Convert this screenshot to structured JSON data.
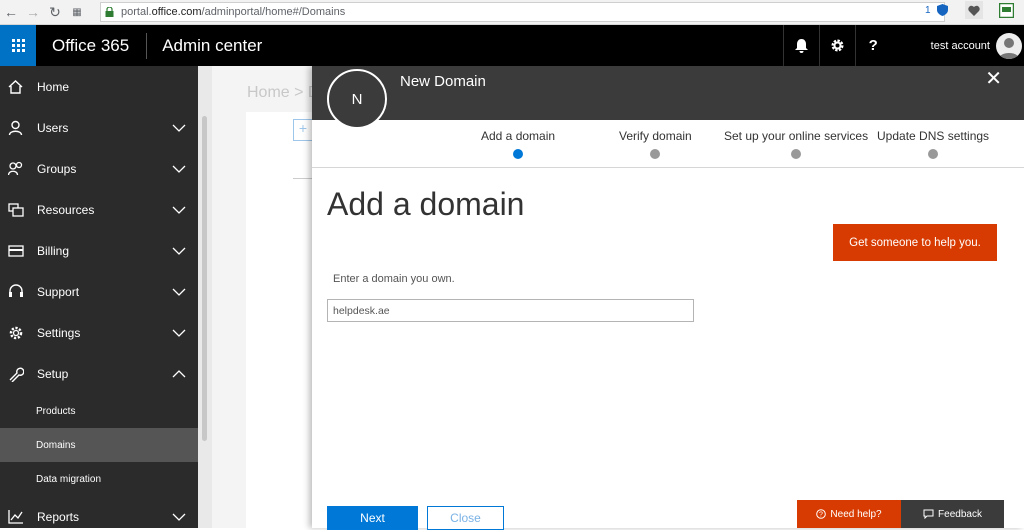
{
  "browser": {
    "url_prefix": "portal.",
    "url_domain": "office.com",
    "url_path": "/adminportal/home#/Domains",
    "badge_count": "1"
  },
  "suite": {
    "brand": "Office 365",
    "app_name": "Admin center",
    "account": "test account"
  },
  "nav": {
    "home": "Home",
    "users": "Users",
    "groups": "Groups",
    "resources": "Resources",
    "billing": "Billing",
    "support": "Support",
    "settings": "Settings",
    "setup": "Setup",
    "sub": {
      "products": "Products",
      "domains": "Domains",
      "data_migration": "Data migration"
    },
    "reports": "Reports"
  },
  "background": {
    "breadcrumb": "Home > D",
    "add_symbol": "+"
  },
  "panel": {
    "avatar_letter": "N",
    "title": "New Domain",
    "close_symbol": "✕",
    "steps": [
      {
        "label": "Add a domain"
      },
      {
        "label": "Verify domain"
      },
      {
        "label": "Set up your online services"
      },
      {
        "label": "Update DNS settings"
      }
    ],
    "heading": "Add a domain",
    "help_button": "Get someone to help you.",
    "field_label": "Enter a domain you own.",
    "domain_value": "helpdesk.ae",
    "next_label": "Next",
    "close_label": "Close"
  },
  "footer": {
    "need_help": "Need help?",
    "feedback": "Feedback"
  },
  "colors": {
    "accent": "#0078d7",
    "orange": "#d83b01",
    "suite_bg": "#000000",
    "nav_bg": "#2b2b2b"
  }
}
